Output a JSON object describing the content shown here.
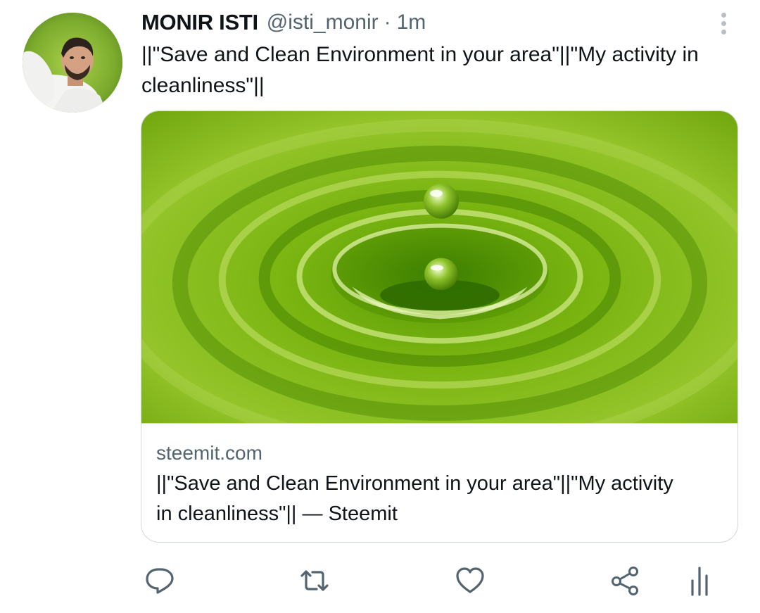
{
  "tweet": {
    "display_name": "MONIR ISTI",
    "handle": "@isti_monir",
    "separator": "·",
    "timestamp": "1m",
    "text": "||\"Save and Clean Environment in your area\"||\"My activity in cleanliness\"||"
  },
  "card": {
    "domain": "steemit.com",
    "title": "||\"Save and Clean Environment in your area\"||\"My activity in cleanliness\"|| — Steemit",
    "image_icon": "green-water-drop-ripple-image"
  },
  "actions": [
    {
      "name": "reply",
      "icon": "reply-icon"
    },
    {
      "name": "retweet",
      "icon": "retweet-icon"
    },
    {
      "name": "like",
      "icon": "heart-icon"
    },
    {
      "name": "share",
      "icon": "share-icon"
    },
    {
      "name": "analytics",
      "icon": "analytics-icon"
    }
  ],
  "colors": {
    "text_primary": "#0f1419",
    "text_secondary": "#536471",
    "border": "#cfd9de",
    "icon": "#536471"
  }
}
